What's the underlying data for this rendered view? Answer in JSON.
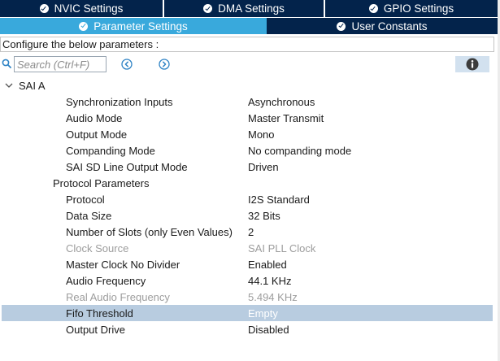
{
  "tabs_row1": [
    {
      "label": "NVIC Settings"
    },
    {
      "label": "DMA Settings"
    },
    {
      "label": "GPIO Settings"
    }
  ],
  "tabs_row2": [
    {
      "label": "Parameter Settings",
      "active": true
    },
    {
      "label": "User Constants",
      "active": false
    }
  ],
  "configure_text": "Configure the below parameters :",
  "search": {
    "placeholder": "Search (Ctrl+F)",
    "value": ""
  },
  "icons": {
    "search": "search-icon",
    "prev": "arrow-left-circle-icon",
    "next": "arrow-right-circle-icon",
    "info": "info-icon",
    "expand": "chevron-down-icon",
    "tab_check": "check-circle-icon"
  },
  "colors": {
    "tab_dark": "#03234b",
    "tab_active": "#39a9dc",
    "selected_row": "#b8cce0",
    "disabled_text": "#9d9d9d",
    "nav_icon": "#2e83c5"
  },
  "tree": {
    "group_label": "SAI A",
    "rows": [
      {
        "name": "Synchronization Inputs",
        "value": "Asynchronous"
      },
      {
        "name": "Audio Mode",
        "value": "Master Transmit"
      },
      {
        "name": "Output Mode",
        "value": "Mono"
      },
      {
        "name": "Companding Mode",
        "value": "No companding mode"
      },
      {
        "name": "SAI SD Line Output Mode",
        "value": "Driven"
      },
      {
        "name": "Protocol Parameters",
        "value": ""
      },
      {
        "name": "Protocol",
        "value": "I2S Standard"
      },
      {
        "name": "Data Size",
        "value": "32 Bits"
      },
      {
        "name": "Number of Slots (only Even Values)",
        "value": "2"
      },
      {
        "name": "Clock Source",
        "value": "SAI PLL Clock",
        "disabled": true
      },
      {
        "name": "Master Clock No Divider",
        "value": "Enabled"
      },
      {
        "name": "Audio Frequency",
        "value": "44.1 KHz"
      },
      {
        "name": "Real Audio Frequency",
        "value": "5.494 KHz",
        "disabled": true
      },
      {
        "name": "Fifo Threshold",
        "value": "Empty",
        "selected": true
      },
      {
        "name": "Output Drive",
        "value": "Disabled"
      }
    ]
  }
}
